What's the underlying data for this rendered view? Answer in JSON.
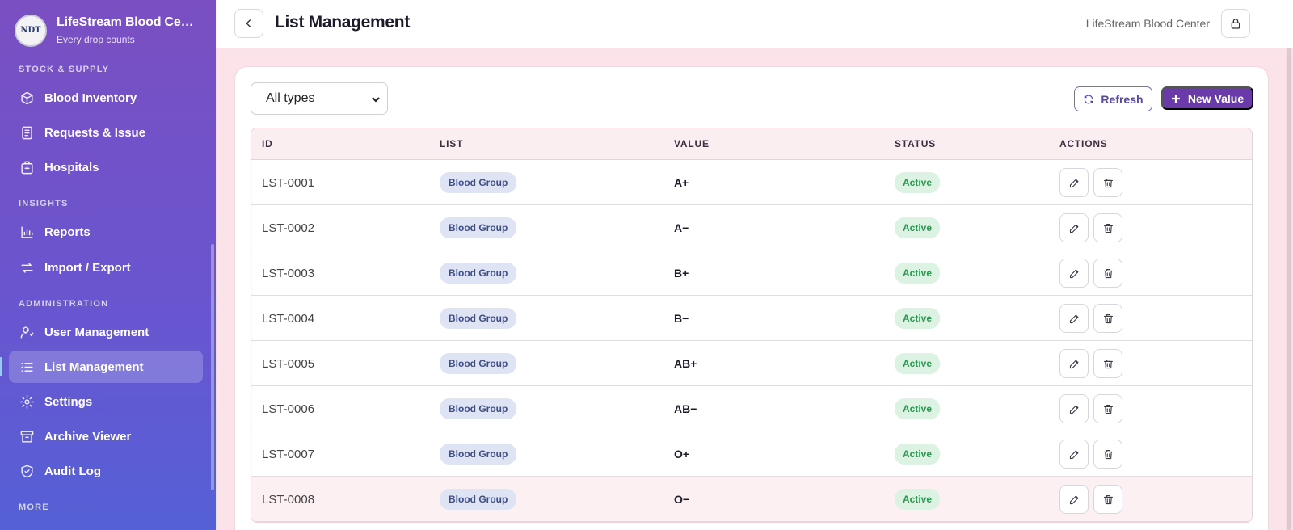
{
  "brand": {
    "logo": "NDT",
    "name": "LifeStream Blood Center",
    "tagline": "Every drop counts"
  },
  "sidebar": {
    "sections": [
      {
        "label": "STOCK & SUPPLY"
      },
      {
        "label": "INSIGHTS"
      },
      {
        "label": "ADMINISTRATION"
      },
      {
        "label": "MORE"
      }
    ],
    "items": [
      {
        "label": "Blood Inventory",
        "icon": "box-icon"
      },
      {
        "label": "Requests & Issue",
        "icon": "document-icon"
      },
      {
        "label": "Hospitals",
        "icon": "hospital-icon"
      },
      {
        "label": "Reports",
        "icon": "bar-chart-icon"
      },
      {
        "label": "Import / Export",
        "icon": "arrows-icon"
      },
      {
        "label": "User Management",
        "icon": "user-cog-icon"
      },
      {
        "label": "List Management",
        "icon": "list-icon",
        "active": true
      },
      {
        "label": "Settings",
        "icon": "gear-icon"
      },
      {
        "label": "Archive Viewer",
        "icon": "archive-icon"
      },
      {
        "label": "Audit Log",
        "icon": "shield-check-icon"
      }
    ]
  },
  "header": {
    "title": "List Management",
    "org": "LifeStream Blood Center"
  },
  "toolbar": {
    "filter_value": "All types",
    "refresh_label": "Refresh",
    "new_label": "New Value"
  },
  "table": {
    "columns": [
      "ID",
      "LIST",
      "VALUE",
      "STATUS",
      "ACTIONS"
    ],
    "rows": [
      {
        "id": "LST-0001",
        "list": "Blood Group",
        "value": "A+",
        "status": "Active"
      },
      {
        "id": "LST-0002",
        "list": "Blood Group",
        "value": "A−",
        "status": "Active"
      },
      {
        "id": "LST-0003",
        "list": "Blood Group",
        "value": "B+",
        "status": "Active"
      },
      {
        "id": "LST-0004",
        "list": "Blood Group",
        "value": "B−",
        "status": "Active"
      },
      {
        "id": "LST-0005",
        "list": "Blood Group",
        "value": "AB+",
        "status": "Active"
      },
      {
        "id": "LST-0006",
        "list": "Blood Group",
        "value": "AB−",
        "status": "Active"
      },
      {
        "id": "LST-0007",
        "list": "Blood Group",
        "value": "O+",
        "status": "Active"
      },
      {
        "id": "LST-0008",
        "list": "Blood Group",
        "value": "O−",
        "status": "Active"
      }
    ]
  },
  "colors": {
    "sidebar_top": "#7a4fc2",
    "sidebar_bottom": "#5560d6",
    "accent": "#6a3aa8",
    "page_bg": "#fbe3e9",
    "active_green": "#2d9650"
  }
}
